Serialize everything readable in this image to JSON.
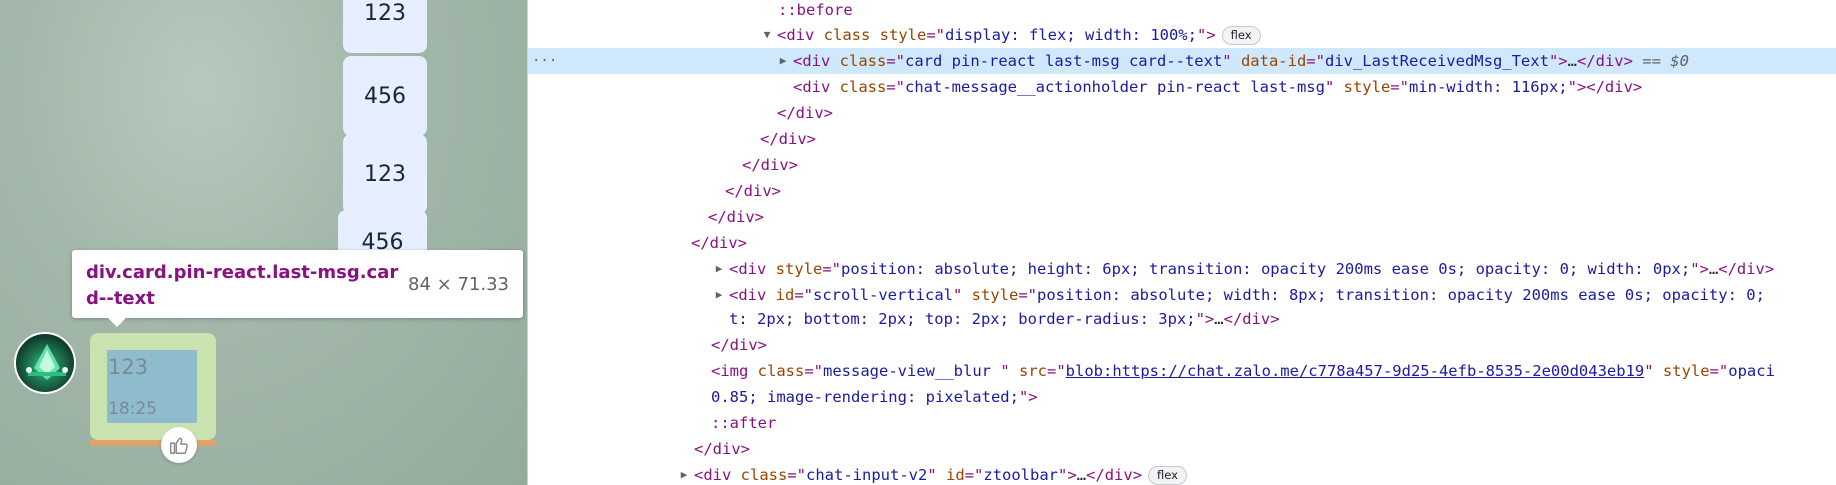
{
  "chat": {
    "bubbles": [
      "123",
      "456",
      "123",
      "456"
    ],
    "tooltip": {
      "selector": "div.card.pin-react.last-msg.card--text",
      "size": "84 × 71.33"
    },
    "selected_message": {
      "text": "123",
      "time": "18:25"
    }
  },
  "devtools": {
    "lines": [
      [
        {
          "c": "pseudo",
          "t": "::before"
        }
      ],
      [
        {
          "c": "tag",
          "t": "<div "
        },
        {
          "c": "an",
          "t": "class "
        },
        {
          "c": "an",
          "t": "style"
        },
        {
          "c": "tag",
          "t": "=\""
        },
        {
          "c": "av",
          "t": "display: flex; width: 100%;"
        },
        {
          "c": "tag",
          "t": "\">"
        },
        {
          "c": "badge",
          "t": "flex"
        }
      ],
      [
        {
          "c": "tag",
          "t": "<div "
        },
        {
          "c": "an",
          "t": "class"
        },
        {
          "c": "tag",
          "t": "=\""
        },
        {
          "c": "av",
          "t": "card  pin-react  last-msg card--text"
        },
        {
          "c": "tag",
          "t": "\" "
        },
        {
          "c": "an",
          "t": "data-id"
        },
        {
          "c": "tag",
          "t": "=\""
        },
        {
          "c": "av",
          "t": "div_LastReceivedMsg_Text"
        },
        {
          "c": "tag",
          "t": "\">"
        },
        {
          "c": "plain",
          "t": "…"
        },
        {
          "c": "tag",
          "t": "</div>"
        },
        {
          "c": "dim",
          "t": " == $0"
        }
      ],
      [
        {
          "c": "tag",
          "t": "<div "
        },
        {
          "c": "an",
          "t": "class"
        },
        {
          "c": "tag",
          "t": "=\""
        },
        {
          "c": "av",
          "t": "chat-message__actionholder  pin-react  last-msg"
        },
        {
          "c": "tag",
          "t": "\" "
        },
        {
          "c": "an",
          "t": "style"
        },
        {
          "c": "tag",
          "t": "=\""
        },
        {
          "c": "av",
          "t": "min-width: 116px;"
        },
        {
          "c": "tag",
          "t": "\"></div>"
        }
      ],
      [
        {
          "c": "tag",
          "t": "</div>"
        }
      ],
      [
        {
          "c": "tag",
          "t": "</div>"
        }
      ],
      [
        {
          "c": "tag",
          "t": "</div>"
        }
      ],
      [
        {
          "c": "tag",
          "t": "</div>"
        }
      ],
      [
        {
          "c": "tag",
          "t": "</div>"
        }
      ],
      [
        {
          "c": "tag",
          "t": "</div>"
        }
      ],
      [
        {
          "c": "tag",
          "t": "<div "
        },
        {
          "c": "an",
          "t": "style"
        },
        {
          "c": "tag",
          "t": "=\""
        },
        {
          "c": "av",
          "t": "position: absolute; height: 6px; transition: opacity 200ms ease 0s; opacity: 0; width: 0px;"
        },
        {
          "c": "tag",
          "t": "\">"
        },
        {
          "c": "plain",
          "t": "…"
        },
        {
          "c": "tag",
          "t": "</div>"
        }
      ],
      [
        {
          "c": "tag",
          "t": "<div "
        },
        {
          "c": "an",
          "t": "id"
        },
        {
          "c": "tag",
          "t": "=\""
        },
        {
          "c": "av",
          "t": "scroll-vertical"
        },
        {
          "c": "tag",
          "t": "\" "
        },
        {
          "c": "an",
          "t": "style"
        },
        {
          "c": "tag",
          "t": "=\""
        },
        {
          "c": "av",
          "t": "position: absolute; width: 8px; transition: opacity 200ms ease 0s; opacity: 0;"
        }
      ],
      [
        {
          "c": "av",
          "t": "t: 2px; bottom: 2px; top: 2px; border-radius: 3px;"
        },
        {
          "c": "tag",
          "t": "\">"
        },
        {
          "c": "plain",
          "t": "…"
        },
        {
          "c": "tag",
          "t": "</div>"
        }
      ],
      [
        {
          "c": "tag",
          "t": "</div>"
        }
      ],
      [
        {
          "c": "tag",
          "t": "<img "
        },
        {
          "c": "an",
          "t": "class"
        },
        {
          "c": "tag",
          "t": "=\""
        },
        {
          "c": "av",
          "t": "message-view__blur "
        },
        {
          "c": "tag",
          "t": "\" "
        },
        {
          "c": "an",
          "t": "src"
        },
        {
          "c": "tag",
          "t": "=\""
        },
        {
          "c": "lnk",
          "t": "blob:https://chat.zalo.me/c778a457-9d25-4efb-8535-2e00d043eb19"
        },
        {
          "c": "tag",
          "t": "\" "
        },
        {
          "c": "an",
          "t": "style"
        },
        {
          "c": "tag",
          "t": "=\""
        },
        {
          "c": "av",
          "t": "opaci"
        }
      ],
      [
        {
          "c": "av",
          "t": "0.85; image-rendering: pixelated;"
        },
        {
          "c": "tag",
          "t": "\">"
        }
      ],
      [
        {
          "c": "pseudo",
          "t": "::after"
        }
      ],
      [
        {
          "c": "tag",
          "t": "</div>"
        }
      ],
      [
        {
          "c": "tag",
          "t": "<div "
        },
        {
          "c": "an",
          "t": "class"
        },
        {
          "c": "tag",
          "t": "=\""
        },
        {
          "c": "av",
          "t": "chat-input-v2"
        },
        {
          "c": "tag",
          "t": "\" "
        },
        {
          "c": "an",
          "t": "id"
        },
        {
          "c": "tag",
          "t": "=\""
        },
        {
          "c": "av",
          "t": "ztoolbar"
        },
        {
          "c": "tag",
          "t": "\">"
        },
        {
          "c": "plain",
          "t": "…"
        },
        {
          "c": "tag",
          "t": "</div>"
        },
        {
          "c": "badge",
          "t": "flex"
        }
      ]
    ],
    "row_menu": "···"
  },
  "colors": {
    "chat_background": "#a3b8aa",
    "bubble": "#e5efff",
    "selected_bubble": "#c9e2b0",
    "inspect_highlight": "#6fa8dc",
    "selected_row": "#cfe8fc",
    "tag": "#881280",
    "attr_name": "#994500",
    "attr_value": "#1a1aa6"
  }
}
